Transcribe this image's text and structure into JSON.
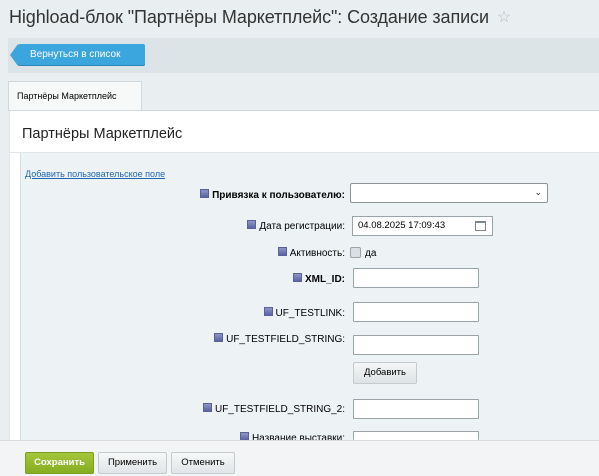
{
  "page": {
    "title": "Highload-блок \"Партнёры Маркетплейс\": Создание записи",
    "star_icon": "star-icon"
  },
  "toolbar": {
    "back_label": "Вернуться в список"
  },
  "tabs": [
    {
      "label": "Партнёры Маркетплейс"
    }
  ],
  "panel": {
    "title": "Партнёры Маркетплейс",
    "add_field_link": "Добавить пользовательское поле"
  },
  "form": {
    "user_link_label": "Привязка к пользователю:",
    "user_link_value": "",
    "reg_date_label": "Дата регистрации:",
    "reg_date_value": "04.08.2025 17:09:43",
    "active_label": "Активность:",
    "active_checkbox_label": "да",
    "xml_id_label": "XML_ID:",
    "testlink_label": "UF_TESTLINK:",
    "testfield_string_label": "UF_TESTFIELD_STRING:",
    "add_button": "Добавить",
    "testfield_string2_label": "UF_TESTFIELD_STRING_2:",
    "cutoff_label": "Название выставки:"
  },
  "footer": {
    "save": "Сохранить",
    "apply": "Применить",
    "cancel": "Отменить"
  },
  "colors": {
    "accent_blue": "#3ba5dd",
    "save_green": "#94b82e",
    "link_blue": "#2067b0"
  }
}
